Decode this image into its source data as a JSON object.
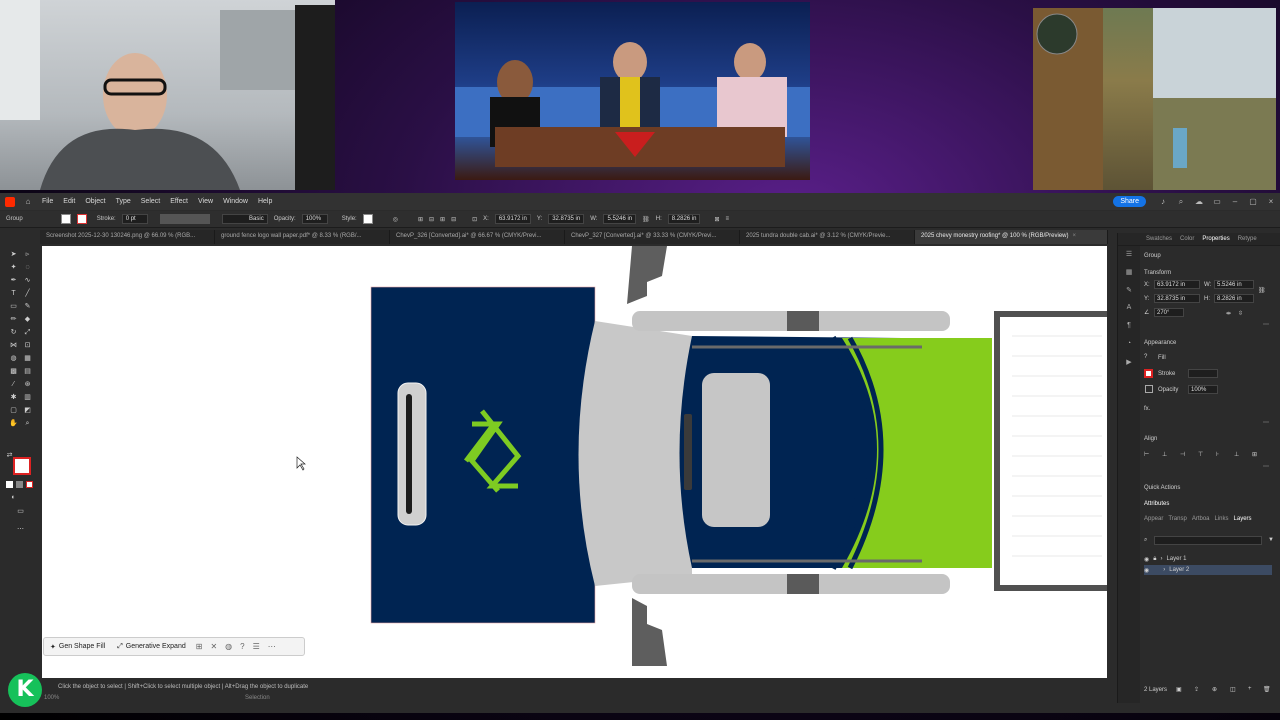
{
  "menubar": {
    "items": [
      "File",
      "Edit",
      "Object",
      "Type",
      "Select",
      "Effect",
      "View",
      "Window",
      "Help"
    ],
    "share_label": "Share"
  },
  "control_bar": {
    "selection_type": "Group",
    "stroke_label": "Stroke:",
    "stroke_value": "0 pt",
    "brush_label": "Basic",
    "opacity_label": "Opacity:",
    "opacity_value": "100%",
    "style_label": "Style:",
    "x_label": "X:",
    "x_value": "63.9172 in",
    "y_label": "Y:",
    "y_value": "32.8735 in",
    "w_label": "W:",
    "w_value": "5.5246 in",
    "h_label": "H:",
    "h_value": "8.2826 in"
  },
  "doc_tabs": [
    {
      "label": "Screenshot 2025-12-30 130246.png @ 66.09 % (RGB...",
      "active": false
    },
    {
      "label": "ground fence logo wall paper.pdf* @ 8.33 % (RGB/...",
      "active": false
    },
    {
      "label": "ChevP_326 [Converted].ai* @ 66.67 % (CMYK/Previ...",
      "active": false
    },
    {
      "label": "ChevP_327 [Converted].ai* @ 33.33 % (CMYK/Previ...",
      "active": false
    },
    {
      "label": "2025 tundra double cab.ai* @ 3.12 % (CMYK/Previe...",
      "active": false
    },
    {
      "label": "2025 chevy monestry roofing* @ 100 % (RGB/Preview)",
      "active": true
    }
  ],
  "gen_bar": {
    "shape_fill_label": "Gen Shape Fill",
    "expand_label": "Generative Expand"
  },
  "status": {
    "zoom": "100%",
    "hint": "Click the object to select  |  Shift+Click to select multiple object  |  Alt+Drag the object to duplicate",
    "tool": "Selection"
  },
  "panel": {
    "tabs": [
      "Swatches",
      "Color",
      "Properties",
      "Retype"
    ],
    "active_tab": "Properties",
    "group_label": "Group",
    "transform_label": "Transform",
    "x_value": "63.9172 in",
    "y_value": "32.8735 in",
    "w_value": "5.5246 in",
    "h_value": "8.2826 in",
    "rotate_value": "270°",
    "appearance_label": "Appearance",
    "fill_label": "Fill",
    "stroke_label": "Stroke",
    "opacity_label": "Opacity",
    "opacity_value": "100%",
    "fx_label": "fx.",
    "align_label": "Align",
    "quick_actions_label": "Quick Actions",
    "attributes_label": "Attributes",
    "sub_tabs": [
      "Appear",
      "Transp",
      "Artboa",
      "Links",
      "Layers"
    ],
    "active_sub_tab": "Layers",
    "layers": [
      {
        "name": "Layer 1",
        "selected": false
      },
      {
        "name": "Layer 2",
        "selected": true
      }
    ],
    "layers_count": "2 Layers"
  },
  "colors": {
    "navy": "#002452",
    "lime": "#84cc16",
    "truck_gray": "#c4c4c4",
    "dark_gray": "#5e5e5e",
    "accent": "#1473e6"
  },
  "logo_badge": "K"
}
